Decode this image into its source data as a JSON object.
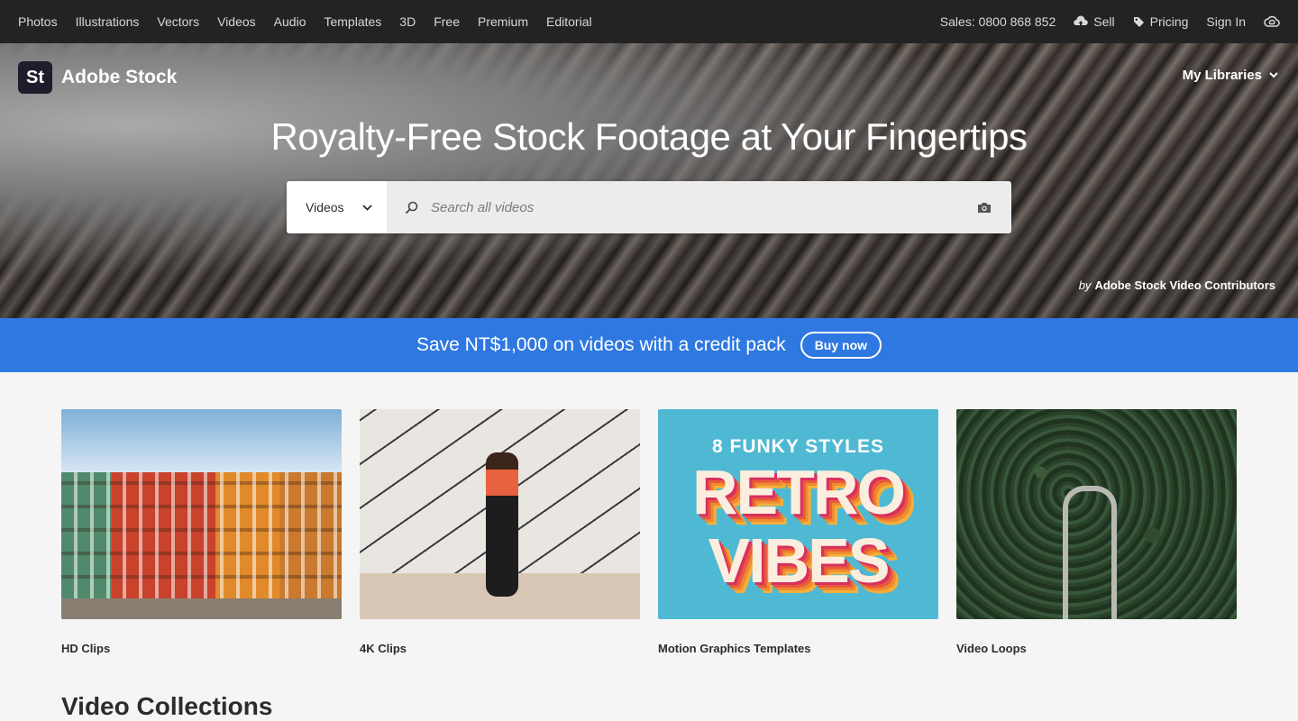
{
  "nav": {
    "links": [
      "Photos",
      "Illustrations",
      "Vectors",
      "Videos",
      "Audio",
      "Templates",
      "3D",
      "Free",
      "Premium",
      "Editorial"
    ],
    "sales": "Sales: 0800 868 852",
    "sell": "Sell",
    "pricing": "Pricing",
    "sign_in": "Sign In"
  },
  "brand": {
    "badge": "St",
    "name": "Adobe Stock"
  },
  "hero": {
    "my_libraries": "My Libraries",
    "headline": "Royalty-Free Stock Footage at Your Fingertips",
    "search_type": "Videos",
    "search_placeholder": "Search all videos",
    "credit_by": "by",
    "credit_name": "Adobe Stock Video Contributors"
  },
  "promo": {
    "text": "Save NT$1,000 on videos with a credit pack",
    "button": "Buy now"
  },
  "cards": [
    {
      "label": "HD Clips"
    },
    {
      "label": "4K Clips"
    },
    {
      "label": "Motion Graphics Templates",
      "art_top": "8 FUNKY STYLES",
      "art_line1": "RETRO",
      "art_line2": "VIBES"
    },
    {
      "label": "Video Loops"
    }
  ],
  "section": {
    "title": "Video Collections"
  }
}
